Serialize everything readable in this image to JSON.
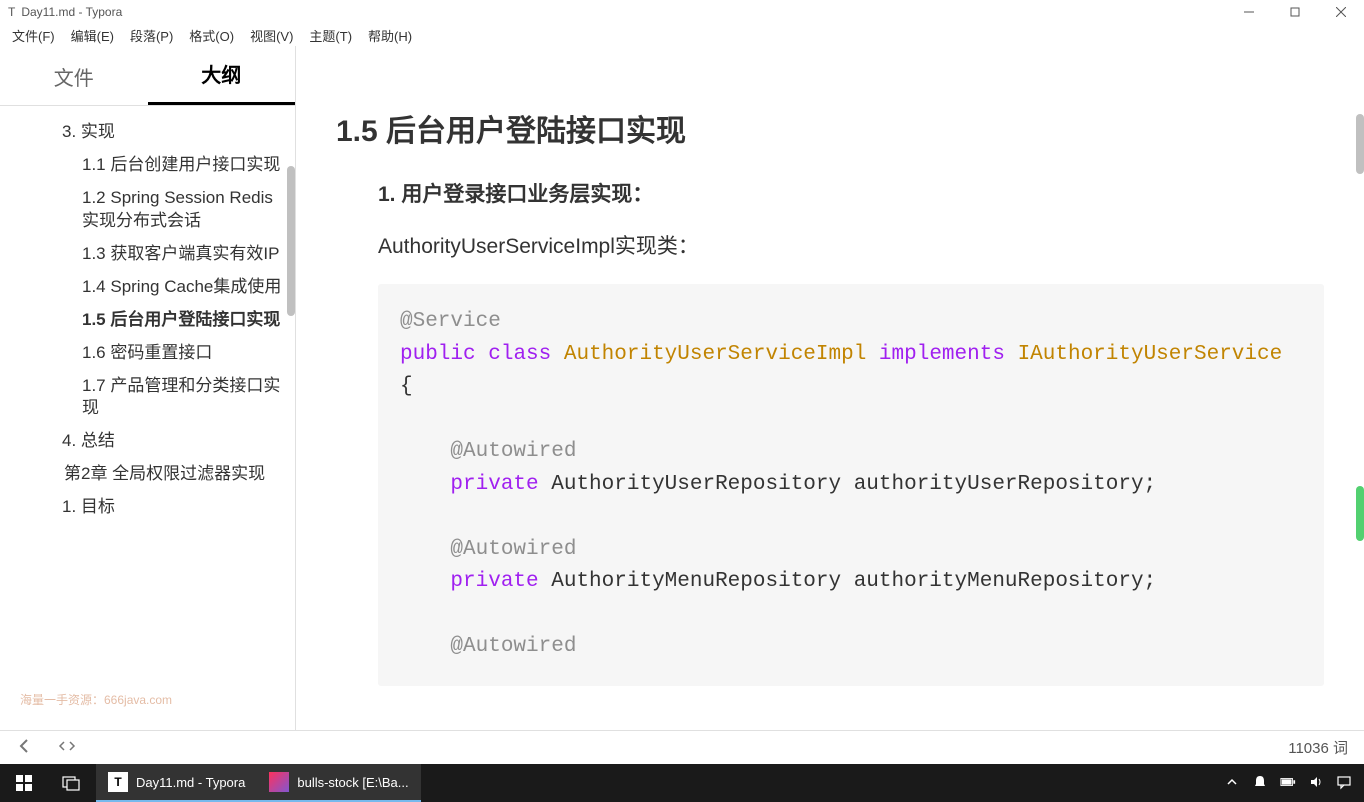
{
  "window": {
    "title": "Day11.md - Typora"
  },
  "menubar": {
    "file": "文件(F)",
    "edit": "编辑(E)",
    "paragraph": "段落(P)",
    "format": "格式(O)",
    "view": "视图(V)",
    "theme": "主题(T)",
    "help": "帮助(H)"
  },
  "sidebar": {
    "tabs": {
      "file": "文件",
      "outline": "大纲"
    },
    "items": [
      {
        "text": "3. 实现",
        "lvl": "lvl1",
        "active": false
      },
      {
        "text": "1.1 后台创建用户接口实现",
        "lvl": "lvl2",
        "active": false
      },
      {
        "text": "1.2 Spring Session Redis实现分布式会话",
        "lvl": "lvl2",
        "active": false
      },
      {
        "text": "1.3 获取客户端真实有效IP",
        "lvl": "lvl2",
        "active": false
      },
      {
        "text": "1.4 Spring Cache集成使用",
        "lvl": "lvl2",
        "active": false
      },
      {
        "text": "1.5 后台用户登陆接口实现",
        "lvl": "lvl2",
        "active": true
      },
      {
        "text": "1.6 密码重置接口",
        "lvl": "lvl2",
        "active": false
      },
      {
        "text": "1.7 产品管理和分类接口实现",
        "lvl": "lvl2",
        "active": false
      },
      {
        "text": "4. 总结",
        "lvl": "lvl1",
        "active": false
      },
      {
        "text": "第2章 全局权限过滤器实现",
        "lvl": "chapter",
        "active": false
      },
      {
        "text": "1. 目标",
        "lvl": "lvl1",
        "active": false
      }
    ]
  },
  "watermark": "海量一手资源：666java.com",
  "content": {
    "heading": "1.5 后台用户登陆接口实现",
    "listItem": "1. 用户登录接口业务层实现：",
    "desc": "AuthorityUserServiceImpl实现类：",
    "code": {
      "l1": "@Service",
      "l2a": "public",
      "l2b": "class",
      "l2c": "AuthorityUserServiceImpl",
      "l2d": "implements",
      "l2e": "IAuthorityUserService",
      "l3": "{",
      "l5": "@Autowired",
      "l6a": "private",
      "l6b": "AuthorityUserRepository authorityUserRepository;",
      "l8": "@Autowired",
      "l9a": "private",
      "l9b": "AuthorityMenuRepository authorityMenuRepository;",
      "l11": "@Autowired"
    }
  },
  "footer": {
    "wordcount": "11036 词"
  },
  "taskbar": {
    "apps": [
      {
        "name": "Day11.md - Typora"
      },
      {
        "name": "bulls-stock [E:\\Ba..."
      }
    ]
  }
}
